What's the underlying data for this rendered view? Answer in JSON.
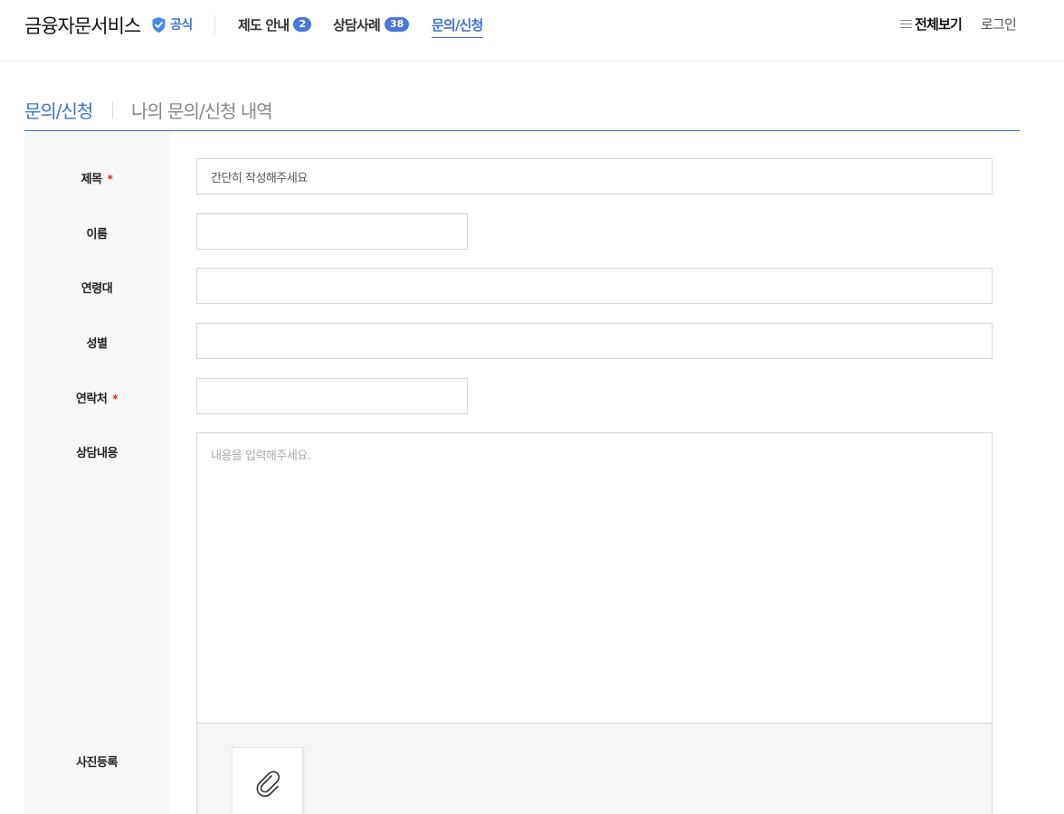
{
  "header": {
    "brand": "금융자문서비스",
    "official_label": "공식",
    "nav": [
      {
        "label": "제도 안내",
        "count": "2"
      },
      {
        "label": "상담사례",
        "count": "38"
      },
      {
        "label": "문의/신청"
      }
    ],
    "menu_all": "전체보기",
    "login": "로그인"
  },
  "tabs": {
    "active": "문의/신청",
    "inactive": "나의 문의/신청 내역"
  },
  "form": {
    "title_label": "제목",
    "title_value": "간단히 작성해주세요",
    "name_label": "이름",
    "age_label": "연령대",
    "gender_label": "성별",
    "contact_label": "연락처",
    "content_label": "상담내용",
    "content_placeholder": "내용을 입력해주세요.",
    "photo_label": "사진등록",
    "required_mark": "*"
  },
  "colors": {
    "accent": "#3f71c8",
    "badge": "#4a78d6",
    "required": "#e1251b"
  },
  "icons": [
    "verified-shield-icon",
    "menu-icon",
    "paperclip-icon"
  ]
}
